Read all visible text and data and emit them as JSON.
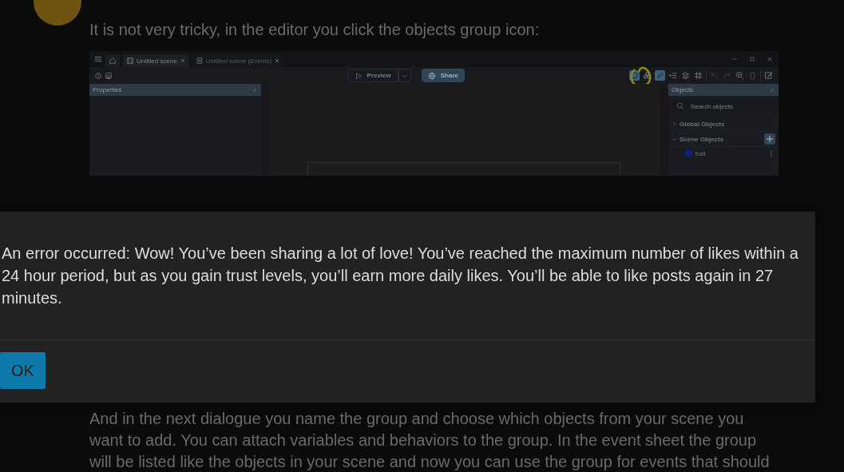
{
  "post": {
    "intro": "It is not very tricky, in the editor you click the objects group icon:",
    "screenshot": {
      "tabs": [
        {
          "label": "Untitled scene",
          "selected": true,
          "kind": "scene"
        },
        {
          "label": "Untitled scene (Events)",
          "selected": false,
          "kind": "events"
        }
      ],
      "preview_button": "Preview",
      "share_button": "Share",
      "properties_panel": {
        "title": "Properties"
      },
      "objects_panel": {
        "title": "Objects",
        "search": {
          "placeholder": "Search objects"
        },
        "groups": [
          {
            "label": "Global Objects",
            "expanded": false
          },
          {
            "label": "Scene Objects",
            "expanded": true,
            "items": [
              {
                "name": "ball"
              }
            ]
          }
        ]
      }
    },
    "outro": "And in the next dialogue you name the group and choose which objects from your scene you want to add. You can attach variables and behaviors to the group. In the event sheet the group will be listed like the objects in your scene and now you can use the group for events that should"
  },
  "dialog": {
    "message": "An error occurred: Wow! You’ve been sharing a lot of love! You’ve reached the maximum number of likes within a 24 hour period, but as you gain trust levels, you’ll earn more daily likes. You’ll be able to like posts again in 27 minutes.",
    "buttons": [
      "OK"
    ]
  }
}
